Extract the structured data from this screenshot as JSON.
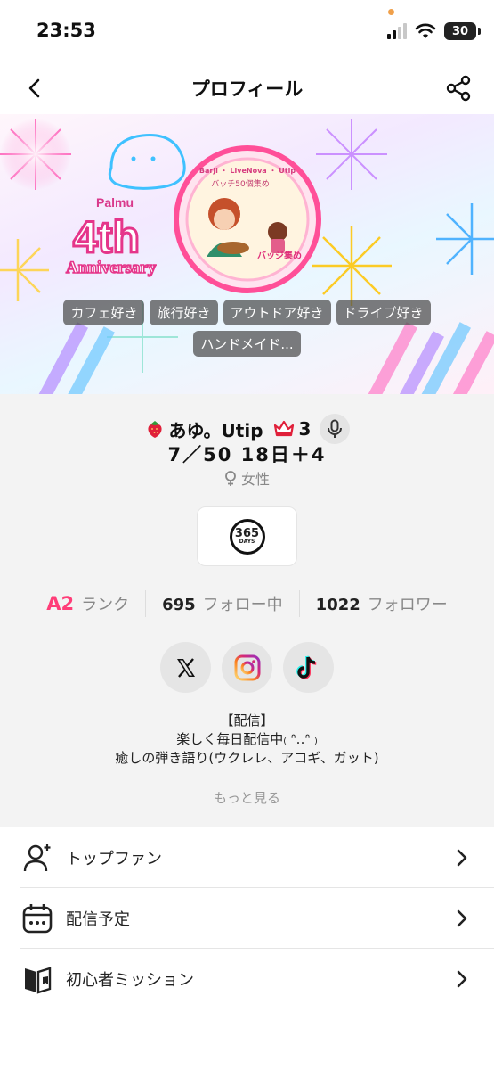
{
  "status_bar": {
    "time": "23:53",
    "battery": "30"
  },
  "nav": {
    "title": "プロフィール"
  },
  "banner": {
    "logo_text": "Palmu",
    "headline": "4th",
    "subline": "Anniversary",
    "emblem_top": "Barji ・ LiveNova ・ Utip",
    "emblem_mid": "バッチ50個集め",
    "emblem_bottom": "バッジ集め",
    "tags": [
      "カフェ好き",
      "旅行好き",
      "アウトドア好き",
      "ドライブ好き",
      "ハンドメイド..."
    ]
  },
  "profile": {
    "name": "あゆ。Utip",
    "level": "3",
    "subname": "7／50 18日＋4",
    "gender": "女性",
    "badge_number": "365",
    "badge_label": "DAYS"
  },
  "stats": [
    {
      "value": "A2",
      "label": "ランク"
    },
    {
      "value": "695",
      "label": "フォロー中"
    },
    {
      "value": "1022",
      "label": "フォロワー"
    }
  ],
  "socials": [
    "x-icon",
    "instagram-icon",
    "tiktok-icon"
  ],
  "bio": {
    "line1": "【配信】",
    "line2": "楽しく毎日配信中₍ ᐢ‥ᐢ ₎",
    "line3": "癒しの弾き語り(ウクレレ、アコギ、ガット)",
    "more": "もっと見る"
  },
  "menu": [
    {
      "label": "トップファン",
      "icon": "user-plus-icon"
    },
    {
      "label": "配信予定",
      "icon": "calendar-icon"
    },
    {
      "label": "初心者ミッション",
      "icon": "book-icon"
    }
  ],
  "colors": {
    "rank": "#ff3d78",
    "accent": "#ff3d78"
  }
}
